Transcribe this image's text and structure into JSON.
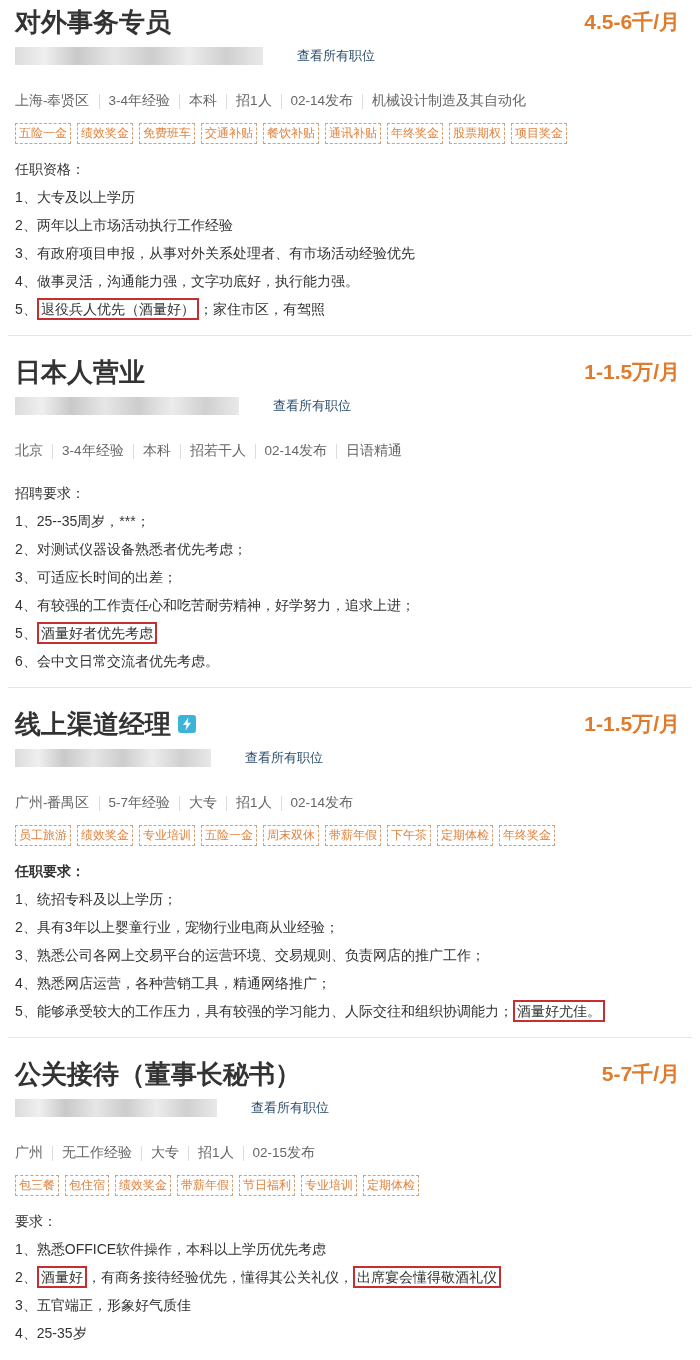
{
  "jobs": [
    {
      "title": "对外事务专员",
      "badge": false,
      "salary": "4.5-6千/月",
      "link": "查看所有职位",
      "meta": [
        "上海-奉贤区",
        "3-4年经验",
        "本科",
        "招1人",
        "02-14发布",
        "机械设计制造及其自动化"
      ],
      "tags": [
        "五险一金",
        "绩效奖金",
        "免费班车",
        "交通补贴",
        "餐饮补贴",
        "通讯补贴",
        "年终奖金",
        "股票期权",
        "项目奖金"
      ],
      "requirements": {
        "heading": "任职资格：",
        "bold": false,
        "lines": [
          {
            "segments": [
              {
                "text": "1、大专及以上学历",
                "boxed": false
              }
            ]
          },
          {
            "segments": [
              {
                "text": "2、两年以上市场活动执行工作经验",
                "boxed": false
              }
            ]
          },
          {
            "segments": [
              {
                "text": "3、有政府项目申报，从事对外关系处理者、有市场活动经验优先",
                "boxed": false
              }
            ]
          },
          {
            "segments": [
              {
                "text": "4、做事灵活，沟通能力强，文字功底好，执行能力强。",
                "boxed": false
              }
            ]
          },
          {
            "segments": [
              {
                "text": "5、",
                "boxed": false
              },
              {
                "text": "退役兵人优先（酒量好）",
                "boxed": true
              },
              {
                "text": "；家住市区，有驾照",
                "boxed": false
              }
            ]
          }
        ]
      }
    },
    {
      "title": "日本人营业",
      "badge": false,
      "salary": "1-1.5万/月",
      "link": "查看所有职位",
      "meta": [
        "北京",
        "3-4年经验",
        "本科",
        "招若干人",
        "02-14发布",
        "日语精通"
      ],
      "requirements": {
        "heading": "招聘要求：",
        "bold": false,
        "lines": [
          {
            "segments": [
              {
                "text": "1、25--35周岁，***；",
                "boxed": false
              }
            ]
          },
          {
            "segments": [
              {
                "text": "2、对测试仪器设备熟悉者优先考虑；",
                "boxed": false
              }
            ]
          },
          {
            "segments": [
              {
                "text": "3、可适应长时间的出差；",
                "boxed": false
              }
            ]
          },
          {
            "segments": [
              {
                "text": "4、有较强的工作责任心和吃苦耐劳精神，好学努力，追求上进；",
                "boxed": false
              }
            ]
          },
          {
            "segments": [
              {
                "text": "5、",
                "boxed": false
              },
              {
                "text": "酒量好者优先考虑",
                "boxed": true
              }
            ]
          },
          {
            "segments": [
              {
                "text": "6、会中文日常交流者优先考虑。",
                "boxed": false
              }
            ]
          }
        ]
      }
    },
    {
      "title": "线上渠道经理",
      "badge": true,
      "salary": "1-1.5万/月",
      "link": "查看所有职位",
      "meta": [
        "广州-番禺区",
        "5-7年经验",
        "大专",
        "招1人",
        "02-14发布"
      ],
      "tags": [
        "员工旅游",
        "绩效奖金",
        "专业培训",
        "五险一金",
        "周末双休",
        "带薪年假",
        "下午茶",
        "定期体检",
        "年终奖金"
      ],
      "requirements": {
        "heading": "任职要求：",
        "bold": true,
        "lines": [
          {
            "segments": [
              {
                "text": "1、统招专科及以上学历；",
                "boxed": false
              }
            ]
          },
          {
            "segments": [
              {
                "text": "2、具有3年以上婴童行业，宠物行业电商从业经验；",
                "boxed": false
              }
            ]
          },
          {
            "segments": [
              {
                "text": "3、熟悉公司各网上交易平台的运营环境、交易规则、负责网店的推广工作；",
                "boxed": false
              }
            ]
          },
          {
            "segments": [
              {
                "text": "4、熟悉网店运营，各种营销工具，精通网络推广；",
                "boxed": false
              }
            ]
          },
          {
            "segments": [
              {
                "text": "5、能够承受较大的工作压力，具有较强的学习能力、人际交往和组织协调能力；",
                "boxed": false
              },
              {
                "text": "酒量好尤佳。",
                "boxed": true
              }
            ]
          }
        ]
      }
    },
    {
      "title": "公关接待（董事长秘书）",
      "badge": false,
      "salary": "5-7千/月",
      "link": "查看所有职位",
      "meta": [
        "广州",
        "无工作经验",
        "大专",
        "招1人",
        "02-15发布"
      ],
      "tags": [
        "包三餐",
        "包住宿",
        "绩效奖金",
        "带薪年假",
        "节日福利",
        "专业培训",
        "定期体检"
      ],
      "requirements": {
        "heading": "要求：",
        "bold": false,
        "lines": [
          {
            "segments": [
              {
                "text": "1、熟悉OFFICE软件操作，本科以上学历优先考虑",
                "boxed": false
              }
            ]
          },
          {
            "segments": [
              {
                "text": "2、",
                "boxed": false
              },
              {
                "text": "酒量好",
                "boxed": true
              },
              {
                "text": "，有商务接待经验优先，懂得其公关礼仪，",
                "boxed": false
              },
              {
                "text": "出席宴会懂得敬酒礼仪",
                "boxed": true
              }
            ]
          },
          {
            "segments": [
              {
                "text": "3、五官端正，形象好气质佳",
                "boxed": false
              }
            ]
          },
          {
            "segments": [
              {
                "text": "4、25-35岁",
                "boxed": false
              }
            ]
          }
        ]
      }
    }
  ]
}
